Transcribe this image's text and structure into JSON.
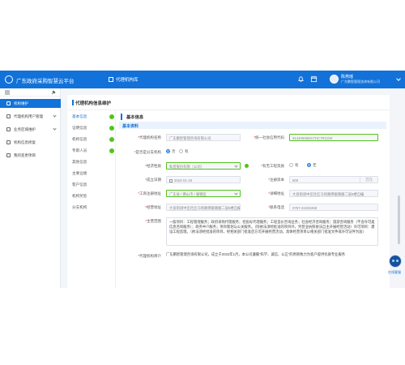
{
  "header": {
    "app_title": "广东政府采购智慧云平台",
    "tab_label": "代理机构库",
    "user_name": "陈燕瑶",
    "user_org": "广东鹏智管理咨询有限公司"
  },
  "sidebar": {
    "items": [
      {
        "label": "机构维护",
        "active": true
      },
      {
        "label": "代理机构用户管理",
        "expandable": true
      },
      {
        "label": "业务区域维护",
        "expandable": true
      },
      {
        "label": "机构信息修复"
      },
      {
        "label": "我的变更项目"
      }
    ]
  },
  "page": {
    "title": "代理机构信息维护",
    "steps": [
      {
        "label": "基本信息",
        "done": true
      },
      {
        "label": "证明信息",
        "done": true
      },
      {
        "label": "机构信息",
        "done": true
      },
      {
        "label": "专职人员",
        "done": true
      },
      {
        "label": "其他信息",
        "done": false
      },
      {
        "label": "主要业绩",
        "done": false
      },
      {
        "label": "客户信息",
        "done": false
      },
      {
        "label": "机构奖惩",
        "done": false
      },
      {
        "label": "分支机构",
        "done": false
      }
    ]
  },
  "form": {
    "section_title": "基本信息",
    "subsection_title": "基本资料",
    "org_name_label": "代理机构名称",
    "org_name": "广东鹏智管理咨询有限公司",
    "credit_code_label": "统一社会信用代码",
    "credit_code": "91440606MA7HC7R1GW",
    "branch_label": "是否是分支机构",
    "branch_options": [
      "否",
      "有"
    ],
    "branch_selected": 1,
    "econ_type_label": "经济性质",
    "econ_type": "私营股份有限（公司）",
    "foreign_label": "有无工程资质",
    "foreign_options": [
      "有",
      "无"
    ],
    "foreign_selected": 1,
    "est_date_label": "成立日期",
    "est_date": "2022-01-19",
    "reg_capital_label": "注册资本",
    "reg_capital": "500",
    "reg_capital_unit": "万元",
    "reg_address_label": "工商注册地址",
    "reg_address": "广东省 / 佛山市 / 顺德区",
    "detail_address_label": "详细地址",
    "detail_address": "大良街道中区社区马场路佛富路雁二层8楼自编",
    "office_address_label": "经营地址",
    "office_address": "大良街道中区社区马场路佛富路雁二层8楼自编",
    "phone_label": "联系电话",
    "phone": "0757-22226268",
    "scope_label": "主营范围",
    "scope_text": "一般项目：工程管理服务；政府采购代理服务；招投标代理服务；工程造价咨询业务；社会经济咨询服务；旅游咨询服务（不含许可类信息咨询服务）；商务中介服务；项目策划与公关服务。（除依法须经批准的项目外，凭营业执照依法自主开展经营活动）许可项目：建设工程监理。（依法须经批准的项目，经相关部门批准后方可开展经营活动，具体经营项目以相关部门批准文件或许可证件为准）",
    "intro_label": "代理机构简介",
    "intro_text": "广东鹏智管理咨询有限公司，成立于2022年1月，本公司遵循“科学、诚信、公正”的原则致力为客户提供优质专业服务"
  },
  "assistant": {
    "label": "在线客服"
  },
  "colors": {
    "primary": "#1272d9",
    "success": "#52c41a",
    "danger": "#f5222d"
  }
}
